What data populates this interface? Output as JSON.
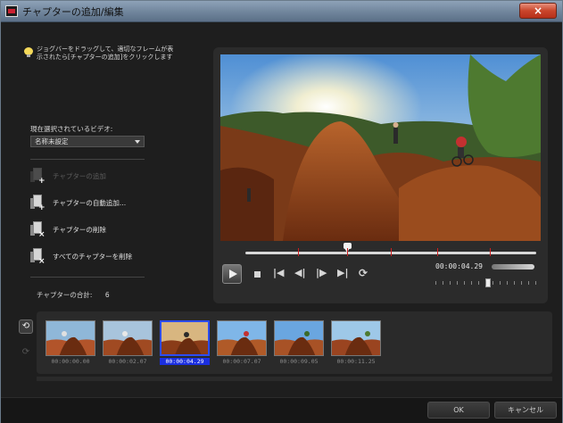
{
  "window": {
    "title": "チャプターの追加/編集",
    "close_label": "×"
  },
  "tip": {
    "text": "ジョグバーをドラッグして、適切なフレームが表示されたら[チャプターの追加]をクリックします"
  },
  "video_select": {
    "label": "現在選択されているビデオ:",
    "value": "名称未設定"
  },
  "actions": [
    {
      "label": "チャプターの追加",
      "enabled": false
    },
    {
      "label": "チャプターの自動追加...",
      "enabled": true
    },
    {
      "label": "チャプターの削除",
      "enabled": true
    },
    {
      "label": "すべてのチャプターを削除",
      "enabled": true
    }
  ],
  "chapter_total": {
    "label": "チャプターの合計:",
    "count": "6"
  },
  "player": {
    "timecode": "00:00:04.29",
    "position_fraction": 0.35,
    "chapter_marks": [
      0.18,
      0.35,
      0.5,
      0.66,
      0.84
    ]
  },
  "chapters": [
    {
      "timecode": "00:00:00.00",
      "selected": false
    },
    {
      "timecode": "00:00:02.07",
      "selected": false
    },
    {
      "timecode": "00:00:04.29",
      "selected": true
    },
    {
      "timecode": "00:00:07.07",
      "selected": false
    },
    {
      "timecode": "00:00:09.05",
      "selected": false
    },
    {
      "timecode": "00:00:11.25",
      "selected": false
    }
  ],
  "footer": {
    "ok_label": "OK",
    "cancel_label": "キャンセル"
  },
  "colors": {
    "selected_border": "#2c4cff",
    "chapter_mark": "#cc2020",
    "close_button": "#c9452b"
  }
}
